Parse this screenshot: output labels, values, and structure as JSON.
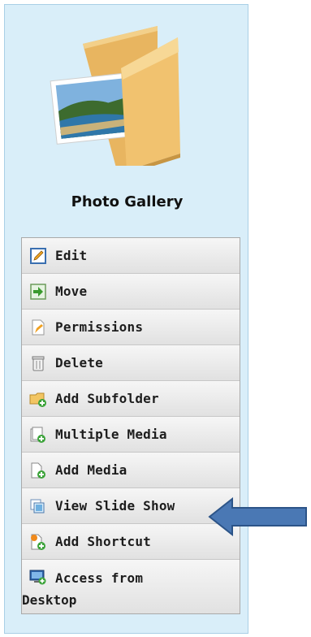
{
  "gallery": {
    "title": "Photo Gallery",
    "icon": "photo-folder-icon"
  },
  "menu": {
    "items": [
      {
        "label": "Edit",
        "icon": "edit-icon"
      },
      {
        "label": "Move",
        "icon": "move-icon"
      },
      {
        "label": "Permissions",
        "icon": "permissions-icon"
      },
      {
        "label": "Delete",
        "icon": "delete-icon"
      },
      {
        "label": "Add Subfolder",
        "icon": "add-subfolder-icon"
      },
      {
        "label": "Multiple Media",
        "icon": "multiple-media-icon"
      },
      {
        "label": "Add Media",
        "icon": "add-media-icon"
      },
      {
        "label": "View Slide Show",
        "icon": "slideshow-icon"
      },
      {
        "label": "Add Shortcut",
        "icon": "add-shortcut-icon"
      },
      {
        "label_line1": "Access from",
        "label_line2": "Desktop",
        "icon": "desktop-access-icon"
      }
    ]
  },
  "callout": {
    "icon": "pointer-arrow-icon",
    "target": "View Slide Show",
    "color": "#4a78b4"
  }
}
